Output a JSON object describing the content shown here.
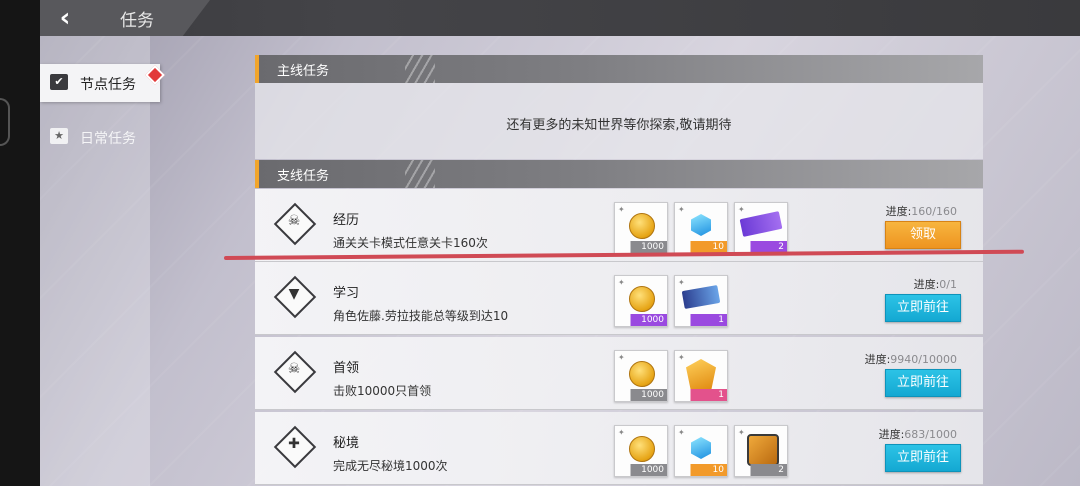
{
  "header": {
    "title": "任务",
    "back_icon": "‹"
  },
  "sidebar": {
    "items": [
      {
        "label": "节点任务",
        "icon": "checkbox-icon",
        "active": true
      },
      {
        "label": "日常任务",
        "icon": "star-icon",
        "active": false
      }
    ]
  },
  "main_section": {
    "title": "主线任务",
    "message": "还有更多的未知世界等你探索,敬请期待"
  },
  "side_section": {
    "title": "支线任务",
    "quests": [
      {
        "name": "经历",
        "desc": "通关关卡模式任意关卡160次",
        "icon": "skull-icon",
        "progress_label": "进度:",
        "progress_value": "160/160",
        "button": "领取",
        "button_type": "claim",
        "rewards": [
          {
            "item": "coin",
            "qty": "1000",
            "bar": "gray"
          },
          {
            "item": "gem",
            "qty": "10",
            "bar": "orange"
          },
          {
            "item": "ticket",
            "qty": "2",
            "bar": "purple"
          }
        ]
      },
      {
        "name": "学习",
        "desc": "角色佐藤.劳拉技能总等级到达10",
        "icon": "chevron-icon",
        "progress_label": "进度:",
        "progress_value": "0/1",
        "button": "立即前往",
        "button_type": "go",
        "rewards": [
          {
            "item": "coin",
            "qty": "1000",
            "bar": "purple"
          },
          {
            "item": "chip",
            "qty": "1",
            "bar": "purple"
          }
        ]
      },
      {
        "name": "首领",
        "desc": "击败10000只首领",
        "icon": "skull-icon",
        "progress_label": "进度:",
        "progress_value": "9940/10000",
        "button": "立即前往",
        "button_type": "go",
        "rewards": [
          {
            "item": "coin",
            "qty": "1000",
            "bar": "gray"
          },
          {
            "item": "badge",
            "qty": "1",
            "bar": "pink"
          }
        ]
      },
      {
        "name": "秘境",
        "desc": "完成无尽秘境1000次",
        "icon": "gamepad-icon",
        "progress_label": "进度:",
        "progress_value": "683/1000",
        "button": "立即前往",
        "button_type": "go",
        "rewards": [
          {
            "item": "coin",
            "qty": "1000",
            "bar": "gray"
          },
          {
            "item": "gem",
            "qty": "10",
            "bar": "orange"
          },
          {
            "item": "crate",
            "qty": "2",
            "bar": "gray"
          }
        ]
      }
    ]
  },
  "colors": {
    "accent": "#f1a52b",
    "claim": "#f29a2a",
    "go": "#14a8d2",
    "annotation": "#d04a55"
  }
}
